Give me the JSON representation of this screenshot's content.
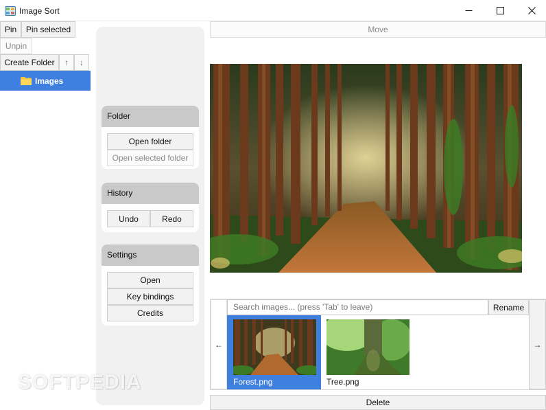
{
  "window": {
    "title": "Image Sort"
  },
  "toolbar": {
    "pin_label": "Pin",
    "pin_selected_label": "Pin selected",
    "unpin_label": "Unpin",
    "create_folder_label": "Create Folder",
    "move_up_label": "↑",
    "move_down_label": "↓"
  },
  "tree": {
    "items": [
      {
        "label": "Images",
        "icon": "folder-icon",
        "selected": true
      }
    ]
  },
  "sidebar": {
    "folder": {
      "heading": "Folder",
      "open_folder_label": "Open folder",
      "open_selected_folder_label": "Open selected folder"
    },
    "history": {
      "heading": "History",
      "undo_label": "Undo",
      "redo_label": "Redo"
    },
    "settings": {
      "heading": "Settings",
      "open_label": "Open",
      "key_bindings_label": "Key bindings",
      "credits_label": "Credits"
    }
  },
  "main": {
    "move_label": "Move",
    "delete_label": "Delete",
    "search_placeholder": "Search images... (press 'Tab' to leave)",
    "rename_label": "Rename",
    "prev_label": "←",
    "next_label": "→",
    "thumbnails": [
      {
        "label": "Forest.png",
        "selected": true
      },
      {
        "label": "Tree.png",
        "selected": false
      }
    ]
  },
  "watermark": "SOFTPEDIA",
  "colors": {
    "accent": "#3f7fdf",
    "group_header": "#c9c9c9",
    "sidebar_bg": "#f1f1f1"
  }
}
